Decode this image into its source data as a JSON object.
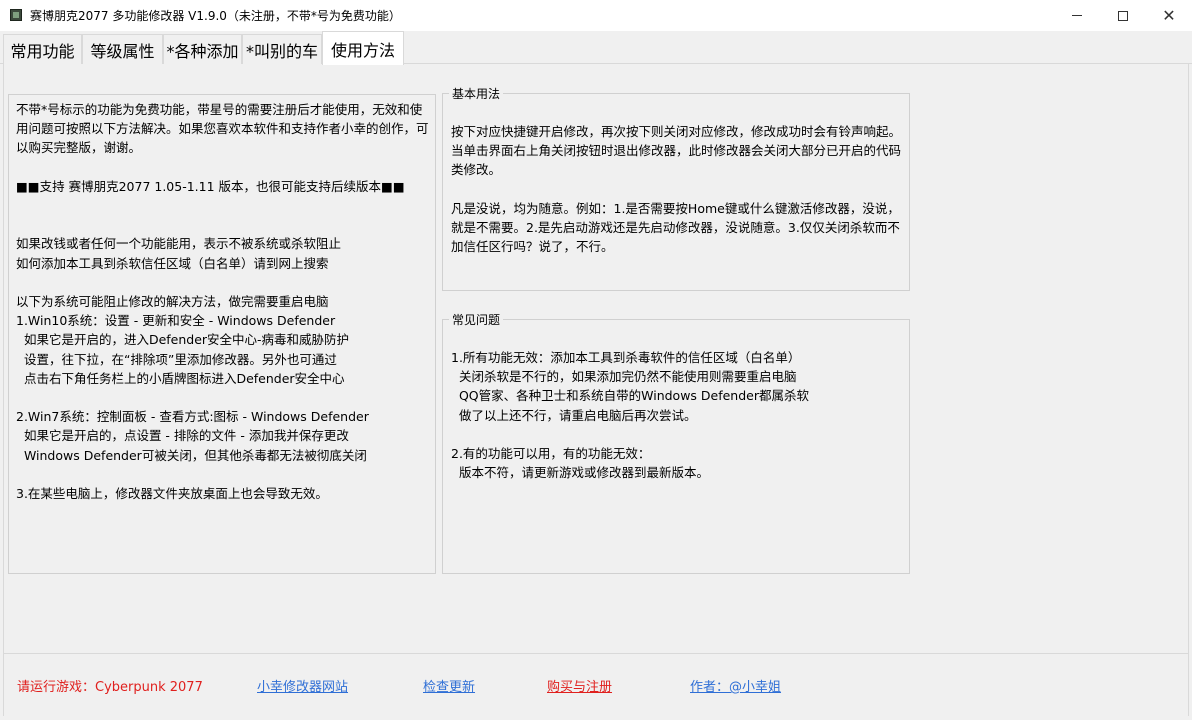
{
  "window": {
    "title": "赛博朋克2077 多功能修改器  V1.9.0（未注册，不带*号为免费功能）",
    "minimize_icon": "minimize-icon",
    "maximize_icon": "maximize-icon",
    "close_icon": "close-icon"
  },
  "tabs": [
    {
      "label": "常用功能"
    },
    {
      "label": "等级属性"
    },
    {
      "label": "*各种添加"
    },
    {
      "label": "*叫别的车"
    },
    {
      "label": "使用方法"
    }
  ],
  "active_tab": "使用方法",
  "left_panel": {
    "text": "不带*号标示的功能为免费功能，带星号的需要注册后才能使用，无效和使用问题可按照以下方法解决。如果您喜欢本软件和支持作者小幸的创作，可以购买完整版，谢谢。\n\n■■支持 赛博朋克2077 1.05-1.11 版本，也很可能支持后续版本■■\n\n\n如果改钱或者任何一个功能能用，表示不被系统或杀软阻止\n如何添加本工具到杀软信任区域（白名单）请到网上搜索\n\n以下为系统可能阻止修改的解决方法，做完需要重启电脑\n1.Win10系统：设置 - 更新和安全 - Windows Defender\n  如果它是开启的，进入Defender安全中心-病毒和威胁防护\n  设置，往下拉，在“排除项”里添加修改器。另外也可通过\n  点击右下角任务栏上的小盾牌图标进入Defender安全中心\n\n2.Win7系统：控制面板 - 查看方式:图标 - Windows Defender\n  如果它是开启的，点设置 - 排除的文件 - 添加我并保存更改\n  Windows Defender可被关闭，但其他杀毒都无法被彻底关闭\n\n3.在某些电脑上，修改器文件夹放桌面上也会导致无效。"
  },
  "basic_usage": {
    "legend": "基本用法",
    "text": "按下对应快捷键开启修改，再次按下则关闭对应修改，修改成功时会有铃声响起。当单击界面右上角关闭按钮时退出修改器，此时修改器会关闭大部分已开启的代码类修改。\n\n凡是没说，均为随意。例如：1.是否需要按Home键或什么键激活修改器，没说，就是不需要。2.是先启动游戏还是先启动修改器，没说随意。3.仅仅关闭杀软而不加信任区行吗？说了，不行。"
  },
  "faq": {
    "legend": "常见问题",
    "text": "1.所有功能无效：添加本工具到杀毒软件的信任区域（白名单）\n  关闭杀软是不行的，如果添加完仍然不能使用则需要重启电脑\n  QQ管家、各种卫士和系统自带的Windows Defender都属杀软\n  做了以上还不行，请重启电脑后再次尝试。\n\n2.有的功能可以用，有的功能无效：\n  版本不符，请更新游戏或修改器到最新版本。"
  },
  "footer": {
    "game_status": "请运行游戏：Cyberpunk 2077",
    "site_link": "小幸修改器网站",
    "update_link": "检查更新",
    "buy_link": "购买与注册",
    "author_link": "作者：@小幸姐"
  },
  "colors": {
    "red": "#e0201e",
    "link_blue": "#2f6fd6",
    "background": "#f0f0f0"
  }
}
